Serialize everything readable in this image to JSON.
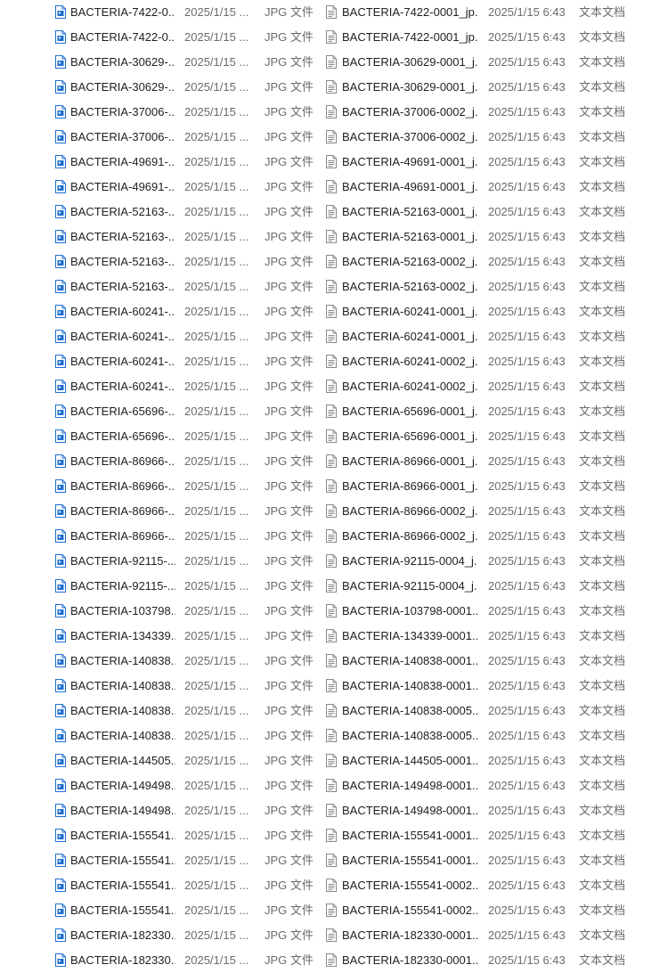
{
  "window": {
    "left_type": "JPG 文件",
    "right_type": "文本文档"
  },
  "rows": [
    {
      "left_name": "BACTERIA-7422-0...",
      "left_date": "2025/1/15 ...",
      "right_name": "BACTERIA-7422-0001_jp...",
      "right_date": "2025/1/15 6:43"
    },
    {
      "left_name": "BACTERIA-7422-0...",
      "left_date": "2025/1/15 ...",
      "right_name": "BACTERIA-7422-0001_jp...",
      "right_date": "2025/1/15 6:43"
    },
    {
      "left_name": "BACTERIA-30629-...",
      "left_date": "2025/1/15 ...",
      "right_name": "BACTERIA-30629-0001_j...",
      "right_date": "2025/1/15 6:43"
    },
    {
      "left_name": "BACTERIA-30629-...",
      "left_date": "2025/1/15 ...",
      "right_name": "BACTERIA-30629-0001_j...",
      "right_date": "2025/1/15 6:43"
    },
    {
      "left_name": "BACTERIA-37006-...",
      "left_date": "2025/1/15 ...",
      "right_name": "BACTERIA-37006-0002_j...",
      "right_date": "2025/1/15 6:43"
    },
    {
      "left_name": "BACTERIA-37006-...",
      "left_date": "2025/1/15 ...",
      "right_name": "BACTERIA-37006-0002_j...",
      "right_date": "2025/1/15 6:43"
    },
    {
      "left_name": "BACTERIA-49691-...",
      "left_date": "2025/1/15 ...",
      "right_name": "BACTERIA-49691-0001_j...",
      "right_date": "2025/1/15 6:43"
    },
    {
      "left_name": "BACTERIA-49691-...",
      "left_date": "2025/1/15 ...",
      "right_name": "BACTERIA-49691-0001_j...",
      "right_date": "2025/1/15 6:43"
    },
    {
      "left_name": "BACTERIA-52163-...",
      "left_date": "2025/1/15 ...",
      "right_name": "BACTERIA-52163-0001_j...",
      "right_date": "2025/1/15 6:43"
    },
    {
      "left_name": "BACTERIA-52163-...",
      "left_date": "2025/1/15 ...",
      "right_name": "BACTERIA-52163-0001_j...",
      "right_date": "2025/1/15 6:43"
    },
    {
      "left_name": "BACTERIA-52163-...",
      "left_date": "2025/1/15 ...",
      "right_name": "BACTERIA-52163-0002_j...",
      "right_date": "2025/1/15 6:43"
    },
    {
      "left_name": "BACTERIA-52163-...",
      "left_date": "2025/1/15 ...",
      "right_name": "BACTERIA-52163-0002_j...",
      "right_date": "2025/1/15 6:43"
    },
    {
      "left_name": "BACTERIA-60241-...",
      "left_date": "2025/1/15 ...",
      "right_name": "BACTERIA-60241-0001_j...",
      "right_date": "2025/1/15 6:43"
    },
    {
      "left_name": "BACTERIA-60241-...",
      "left_date": "2025/1/15 ...",
      "right_name": "BACTERIA-60241-0001_j...",
      "right_date": "2025/1/15 6:43"
    },
    {
      "left_name": "BACTERIA-60241-...",
      "left_date": "2025/1/15 ...",
      "right_name": "BACTERIA-60241-0002_j...",
      "right_date": "2025/1/15 6:43"
    },
    {
      "left_name": "BACTERIA-60241-...",
      "left_date": "2025/1/15 ...",
      "right_name": "BACTERIA-60241-0002_j...",
      "right_date": "2025/1/15 6:43"
    },
    {
      "left_name": "BACTERIA-65696-...",
      "left_date": "2025/1/15 ...",
      "right_name": "BACTERIA-65696-0001_j...",
      "right_date": "2025/1/15 6:43"
    },
    {
      "left_name": "BACTERIA-65696-...",
      "left_date": "2025/1/15 ...",
      "right_name": "BACTERIA-65696-0001_j...",
      "right_date": "2025/1/15 6:43"
    },
    {
      "left_name": "BACTERIA-86966-...",
      "left_date": "2025/1/15 ...",
      "right_name": "BACTERIA-86966-0001_j...",
      "right_date": "2025/1/15 6:43"
    },
    {
      "left_name": "BACTERIA-86966-...",
      "left_date": "2025/1/15 ...",
      "right_name": "BACTERIA-86966-0001_j...",
      "right_date": "2025/1/15 6:43"
    },
    {
      "left_name": "BACTERIA-86966-...",
      "left_date": "2025/1/15 ...",
      "right_name": "BACTERIA-86966-0002_j...",
      "right_date": "2025/1/15 6:43"
    },
    {
      "left_name": "BACTERIA-86966-...",
      "left_date": "2025/1/15 ...",
      "right_name": "BACTERIA-86966-0002_j...",
      "right_date": "2025/1/15 6:43"
    },
    {
      "left_name": "BACTERIA-92115-...",
      "left_date": "2025/1/15 ...",
      "right_name": "BACTERIA-92115-0004_j...",
      "right_date": "2025/1/15 6:43"
    },
    {
      "left_name": "BACTERIA-92115-...",
      "left_date": "2025/1/15 ...",
      "right_name": "BACTERIA-92115-0004_j...",
      "right_date": "2025/1/15 6:43"
    },
    {
      "left_name": "BACTERIA-103798...",
      "left_date": "2025/1/15 ...",
      "right_name": "BACTERIA-103798-0001...",
      "right_date": "2025/1/15 6:43"
    },
    {
      "left_name": "BACTERIA-134339...",
      "left_date": "2025/1/15 ...",
      "right_name": "BACTERIA-134339-0001...",
      "right_date": "2025/1/15 6:43"
    },
    {
      "left_name": "BACTERIA-140838...",
      "left_date": "2025/1/15 ...",
      "right_name": "BACTERIA-140838-0001...",
      "right_date": "2025/1/15 6:43"
    },
    {
      "left_name": "BACTERIA-140838...",
      "left_date": "2025/1/15 ...",
      "right_name": "BACTERIA-140838-0001...",
      "right_date": "2025/1/15 6:43"
    },
    {
      "left_name": "BACTERIA-140838...",
      "left_date": "2025/1/15 ...",
      "right_name": "BACTERIA-140838-0005...",
      "right_date": "2025/1/15 6:43"
    },
    {
      "left_name": "BACTERIA-140838...",
      "left_date": "2025/1/15 ...",
      "right_name": "BACTERIA-140838-0005...",
      "right_date": "2025/1/15 6:43"
    },
    {
      "left_name": "BACTERIA-144505...",
      "left_date": "2025/1/15 ...",
      "right_name": "BACTERIA-144505-0001...",
      "right_date": "2025/1/15 6:43"
    },
    {
      "left_name": "BACTERIA-149498...",
      "left_date": "2025/1/15 ...",
      "right_name": "BACTERIA-149498-0001...",
      "right_date": "2025/1/15 6:43"
    },
    {
      "left_name": "BACTERIA-149498...",
      "left_date": "2025/1/15 ...",
      "right_name": "BACTERIA-149498-0001...",
      "right_date": "2025/1/15 6:43"
    },
    {
      "left_name": "BACTERIA-155541...",
      "left_date": "2025/1/15 ...",
      "right_name": "BACTERIA-155541-0001...",
      "right_date": "2025/1/15 6:43"
    },
    {
      "left_name": "BACTERIA-155541...",
      "left_date": "2025/1/15 ...",
      "right_name": "BACTERIA-155541-0001...",
      "right_date": "2025/1/15 6:43"
    },
    {
      "left_name": "BACTERIA-155541...",
      "left_date": "2025/1/15 ...",
      "right_name": "BACTERIA-155541-0002...",
      "right_date": "2025/1/15 6:43"
    },
    {
      "left_name": "BACTERIA-155541...",
      "left_date": "2025/1/15 ...",
      "right_name": "BACTERIA-155541-0002...",
      "right_date": "2025/1/15 6:43"
    },
    {
      "left_name": "BACTERIA-182330...",
      "left_date": "2025/1/15 ...",
      "right_name": "BACTERIA-182330-0001...",
      "right_date": "2025/1/15 6:43"
    },
    {
      "left_name": "BACTERIA-182330...",
      "left_date": "2025/1/15 ...",
      "right_name": "BACTERIA-182330-0001...",
      "right_date": "2025/1/15 6:43"
    }
  ],
  "icons": {
    "left": "jpg-file-icon",
    "right": "text-file-icon"
  },
  "colors": {
    "jpg_icon": "#1f6fd1",
    "text_icon": "#8a8a8a",
    "secondary_text": "#6b6b6b"
  }
}
